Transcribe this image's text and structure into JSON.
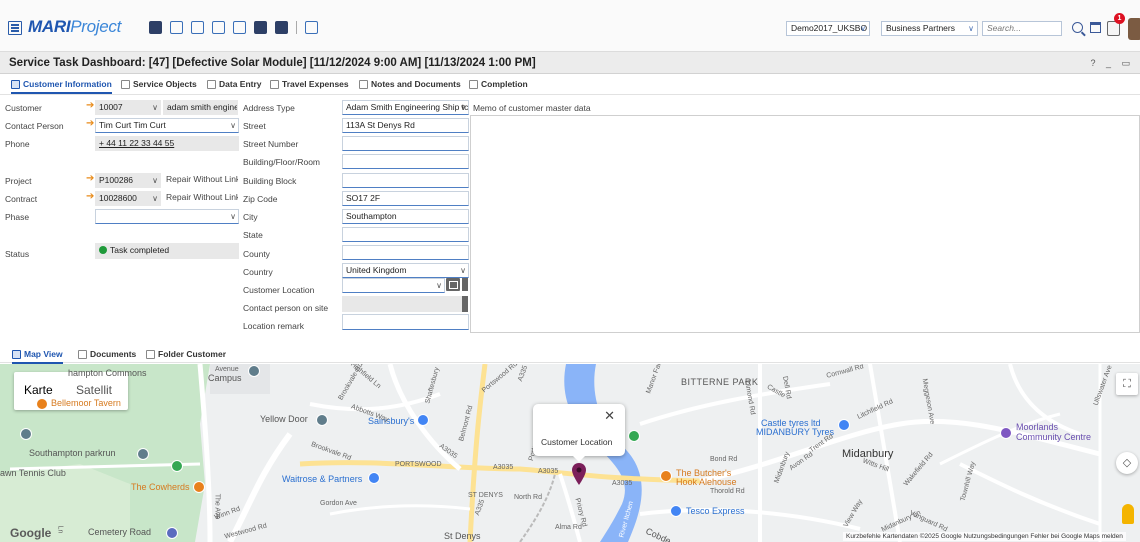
{
  "header": {
    "logo_brand": "MARI",
    "logo_suffix": "Project",
    "db_select": "Demo2017_UKSBO",
    "module_select": "Business Partners",
    "search_placeholder": "Search...",
    "notification_count": "1"
  },
  "title": {
    "text": "Service Task Dashboard: [47] [Defective Solar Module] [11/12/2024 9:00 AM] [11/13/2024 1:00 PM]",
    "controls": "? _ ▭"
  },
  "tabs": [
    {
      "label": "Customer Information"
    },
    {
      "label": "Service Objects"
    },
    {
      "label": "Data Entry"
    },
    {
      "label": "Travel Expenses"
    },
    {
      "label": "Notes and Documents"
    },
    {
      "label": "Completion"
    }
  ],
  "left_form": {
    "customer_label": "Customer",
    "customer_code": "10007",
    "customer_name": "adam smith engineeri",
    "contact_label": "Contact Person",
    "contact_value": "Tim Curt Tim  Curt",
    "phone_label": "Phone",
    "phone_value": "+ 44 11 22 33 44 55",
    "project_label": "Project",
    "project_code": "P100286",
    "project_name": "Repair Without Link",
    "contract_label": "Contract",
    "contract_code": "10028600",
    "contract_name": "Repair Without Link",
    "phase_label": "Phase",
    "phase_value": "",
    "status_label": "Status",
    "status_value": "Task completed"
  },
  "address": {
    "address_type_label": "Address Type",
    "address_type_value": "Adam Smith Engineering Ship tc",
    "street_label": "Street",
    "street_value": "113A St Denys Rd",
    "street_number_label": "Street Number",
    "building_label": "Building/Floor/Room",
    "block_label": "Building Block",
    "zip_label": "Zip Code",
    "zip_value": "SO17 2F",
    "city_label": "City",
    "city_value": "Southampton",
    "state_label": "State",
    "county_label": "County",
    "country_label": "Country",
    "country_value": "United Kingdom",
    "customer_location_label": "Customer Location",
    "contact_on_site_label": "Contact person on site",
    "location_remark_label": "Location remark"
  },
  "memo": {
    "label": "Memo of customer master data"
  },
  "map_tabs": [
    {
      "label": "Map View"
    },
    {
      "label": "Documents"
    },
    {
      "label": "Folder Customer"
    }
  ],
  "map": {
    "type_map": "Karte",
    "type_satellite": "Satellit",
    "popup_text": "Customer Location",
    "labels": {
      "hampton_commons": "hampton Commons",
      "bellemoor": "Bellemoor Tavern",
      "parkrun": "Southampton parkrun",
      "tennis": "awn Tennis Club",
      "cowherds": "The Cowherds",
      "cemetery": "Cemetery Road",
      "campus": "Campus",
      "avenue": "Avenue",
      "yellow_door": "Yellow Door",
      "sainsburys": "Sainsbury's",
      "waitrose": "Waitrose & Partners",
      "portswood": "PORTSWOOD",
      "st_denys": "ST DENYS",
      "st_denys_station": "St Denys",
      "bitterne_park": "BITTERNE PARK",
      "castle_tyres": "Castle tyres ltd",
      "midanbury_tyres": "MIDANBURY Tyres",
      "midanbury": "Midanbury",
      "moorlands": "Moorlands",
      "community_centre": "Community Centre",
      "butchers": "The Butcher's",
      "hook_alehouse": "Hook Alehouse",
      "tesco": "Tesco Express",
      "a3035_1": "A3035",
      "a3035_2": "A3035",
      "a3035_3": "A3035",
      "a335": "A335",
      "north_rd": "North Rd",
      "bond_rd": "Bond Rd",
      "thorold_rd": "Thorold Rd",
      "gordon_ave": "Gordon Ave",
      "priory_rd": "Priory Rd",
      "river_itchen": "River Itchen",
      "cornwall_rd": "Cornwall Rd",
      "witts_hill": "Witts Hill",
      "townhill_way": "Townhill Way",
      "vanguard_rd": "Vanguard Rd",
      "cobden": "Cobde",
      "highfield_ln": "Highfield Ln",
      "brookvale_rd": "Brookvale Rd",
      "abbotts_way": "Abbotts Way",
      "belmont_rd": "Belmont Rd",
      "portswood_rd": "Portswood Rd",
      "shaftesbury": "Shaftesbury",
      "litchfield_rd": "Litchfield Rd",
      "manor_farm": "Manor Farm",
      "dimond_rd": "Dimond Rd",
      "avon_rd": "Avon Rd",
      "trent_rd": "Trent Rd",
      "winn_rd": "Winn Rd",
      "westwood_rd": "Westwood Rd",
      "alma_rd": "Alma Rd",
      "the_ave": "The Ave",
      "ln": "Ln",
      "megan_ave": "Meggeson Ave",
      "dell_rd": "Dell Rd",
      "view_way": "View Way",
      "wakefield_rd": "Wakefield Rd",
      "midanbury_ln": "Midanbury Ln",
      "ullswater_ave": "Ullswater Ave",
      "castle_way": "Castle",
      "highfield": "Highfield",
      "google": "Google"
    },
    "attribution": "Kurzbefehle    Kartendaten ©2025 Google    Nutzungsbedingungen    Fehler bei Google Maps melden"
  },
  "colors": {
    "accent": "#1f56b0",
    "status_green": "#1f9a3a",
    "required_arrow": "#e88b1a",
    "river": "#8ab4f8",
    "park": "#c8e6c9"
  }
}
